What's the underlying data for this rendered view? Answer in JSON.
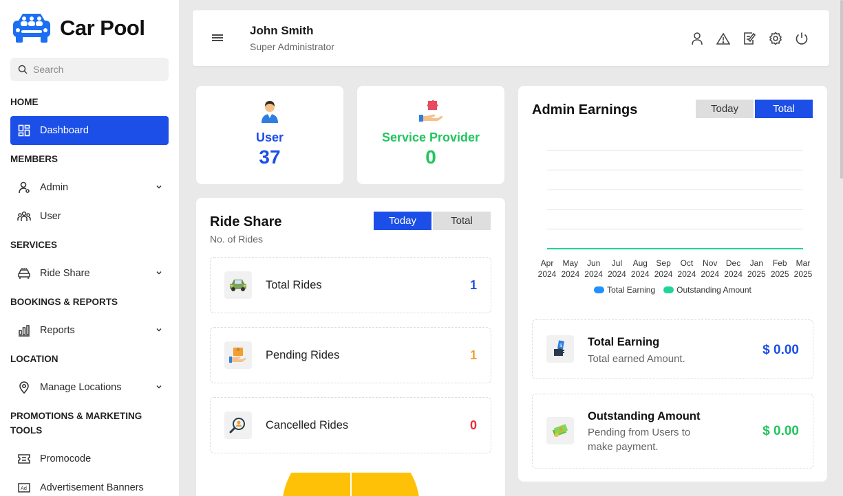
{
  "brand": {
    "name": "Car Pool",
    "color": "#1c6ef2"
  },
  "search": {
    "placeholder": "Search"
  },
  "sidebar": {
    "sections": [
      {
        "label": "HOME"
      },
      {
        "label": "MEMBERS"
      },
      {
        "label": "SERVICES"
      },
      {
        "label": "BOOKINGS & REPORTS"
      },
      {
        "label": "LOCATION"
      },
      {
        "label": "PROMOTIONS & MARKETING TOOLS"
      }
    ],
    "items": [
      {
        "label": "Dashboard",
        "icon": "dashboard-icon",
        "active": true
      },
      {
        "label": "Admin",
        "icon": "admin-icon"
      },
      {
        "label": "User",
        "icon": "users-icon"
      },
      {
        "label": "Ride Share",
        "icon": "car-icon"
      },
      {
        "label": "Reports",
        "icon": "bar-chart-icon"
      },
      {
        "label": "Manage Locations",
        "icon": "location-pin-icon"
      },
      {
        "label": "Promocode",
        "icon": "ticket-icon"
      },
      {
        "label": "Advertisement Banners",
        "icon": "ad-icon"
      }
    ]
  },
  "header": {
    "user_name": "John Smith",
    "user_role": "Super Administrator",
    "icons": [
      "profile-icon",
      "alert-icon",
      "edit-icon",
      "settings-icon",
      "power-icon"
    ]
  },
  "stats": {
    "user": {
      "label": "User",
      "value": "37",
      "color": "#1c4ee8"
    },
    "provider": {
      "label": "Service Provider",
      "value": "0",
      "color": "#22c55e"
    }
  },
  "ride_share": {
    "title": "Ride Share",
    "subtitle": "No. of Rides",
    "toggle": {
      "today": "Today",
      "total": "Total",
      "selected": "today"
    },
    "rows": [
      {
        "label": "Total Rides",
        "value": "1",
        "color": "#1c4ee8"
      },
      {
        "label": "Pending Rides",
        "value": "1",
        "color": "#f0a030"
      },
      {
        "label": "Cancelled Rides",
        "value": "0",
        "color": "#ef2b3c"
      }
    ]
  },
  "admin_earnings": {
    "title": "Admin Earnings",
    "toggle": {
      "today": "Today",
      "total": "Total",
      "selected": "total"
    },
    "total_earning": {
      "title": "Total Earning",
      "sub": "Total earned Amount.",
      "value": "$ 0.00",
      "color": "#1c4ee8"
    },
    "outstanding": {
      "title": "Outstanding Amount",
      "sub": "Pending from Users to make payment.",
      "value": "$ 0.00",
      "color": "#22c55e"
    }
  },
  "chart_data": {
    "type": "line",
    "categories": [
      [
        "Apr",
        "2024"
      ],
      [
        "May",
        "2024"
      ],
      [
        "Jun",
        "2024"
      ],
      [
        "Jul",
        "2024"
      ],
      [
        "Aug",
        "2024"
      ],
      [
        "Sep",
        "2024"
      ],
      [
        "Oct",
        "2024"
      ],
      [
        "Nov",
        "2024"
      ],
      [
        "Dec",
        "2024"
      ],
      [
        "Jan",
        "2025"
      ],
      [
        "Feb",
        "2025"
      ],
      [
        "Mar",
        "2025"
      ]
    ],
    "series": [
      {
        "name": "Total Earning",
        "color": "#1e90ff",
        "values": [
          0,
          0,
          0,
          0,
          0,
          0,
          0,
          0,
          0,
          0,
          0,
          0
        ]
      },
      {
        "name": "Outstanding Amount",
        "color": "#20d39a",
        "values": [
          0,
          0,
          0,
          0,
          0,
          0,
          0,
          0,
          0,
          0,
          0,
          0
        ]
      }
    ],
    "grid": true,
    "legend": "bottom"
  }
}
